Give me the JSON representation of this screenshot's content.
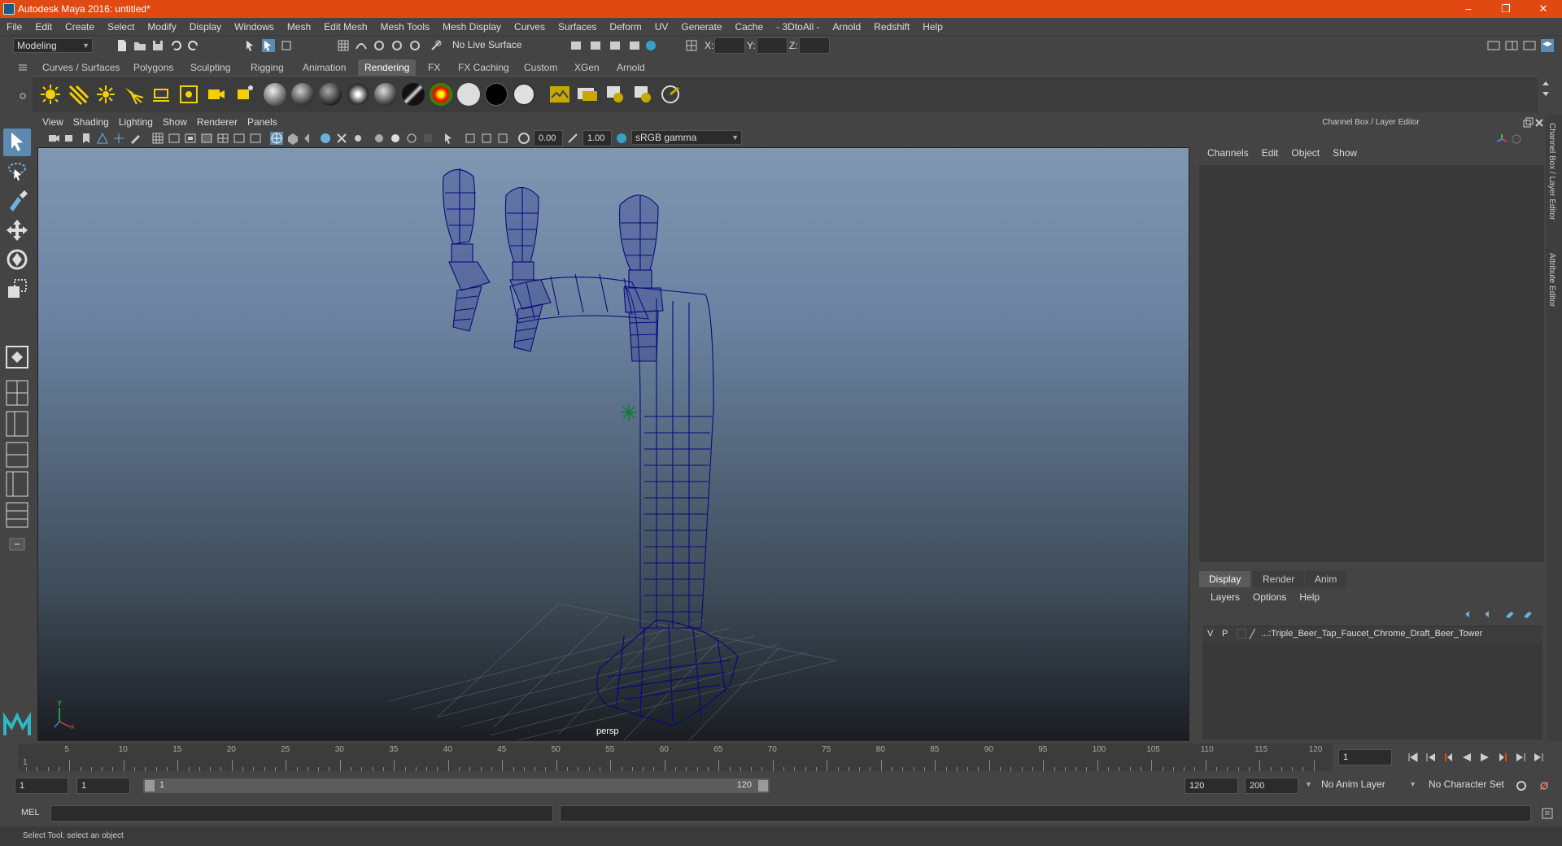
{
  "window": {
    "title": "Autodesk Maya 2016: untitled*",
    "controls": [
      "–",
      "❐",
      "✕"
    ]
  },
  "menu": [
    "File",
    "Edit",
    "Create",
    "Select",
    "Modify",
    "Display",
    "Windows",
    "Mesh",
    "Edit Mesh",
    "Mesh Tools",
    "Mesh Display",
    "Curves",
    "Surfaces",
    "Deform",
    "UV",
    "Generate",
    "Cache",
    "- 3DtoAll -",
    "Arnold",
    "Redshift",
    "Help"
  ],
  "status": {
    "mode": "Modeling",
    "live_surface": "No Live Surface",
    "x_label": "X:",
    "y_label": "Y:",
    "z_label": "Z:"
  },
  "shelf_tabs": [
    "Curves / Surfaces",
    "Polygons",
    "Sculpting",
    "Rigging",
    "Animation",
    "Rendering",
    "FX",
    "FX Caching",
    "Custom",
    "XGen",
    "Arnold"
  ],
  "active_shelf": "Rendering",
  "viewport": {
    "menu": [
      "View",
      "Shading",
      "Lighting",
      "Show",
      "Renderer",
      "Panels"
    ],
    "exposure": "0.00",
    "gamma": "1.00",
    "color_space": "sRGB gamma",
    "camera": "persp",
    "axis_x": "x",
    "axis_y": "y"
  },
  "channel_box": {
    "header": "Channel Box / Layer Editor",
    "menu": [
      "Channels",
      "Edit",
      "Object",
      "Show"
    ]
  },
  "layer_editor": {
    "tabs": [
      "Display",
      "Render",
      "Anim"
    ],
    "active_tab": "Display",
    "menu": [
      "Layers",
      "Options",
      "Help"
    ],
    "rows": [
      {
        "v": "V",
        "p": "P",
        "name": "...:Triple_Beer_Tap_Faucet_Chrome_Draft_Beer_Tower"
      }
    ]
  },
  "side_tabs": [
    "Channel Box / Layer Editor",
    "Attribute Editor"
  ],
  "timeline": {
    "ticks": [
      "5",
      "10",
      "15",
      "20",
      "25",
      "30",
      "35",
      "40",
      "45",
      "50",
      "55",
      "60",
      "65",
      "70",
      "75",
      "80",
      "85",
      "90",
      "95",
      "100",
      "105",
      "110",
      "115",
      "120"
    ],
    "start_label": "1",
    "current_frame": "1"
  },
  "range": {
    "start": "1",
    "playback_start": "1",
    "slider_start": "1",
    "slider_end": "120",
    "playback_end": "120",
    "end": "200",
    "anim_layer": "No Anim Layer",
    "character_set": "No Character Set"
  },
  "command": {
    "label": "MEL"
  },
  "help_line": "Select Tool: select an object",
  "colors": {
    "title_bar": "#e04a12",
    "wireframe": "#0a0a7a",
    "active_tool": "#5d8ab0"
  }
}
